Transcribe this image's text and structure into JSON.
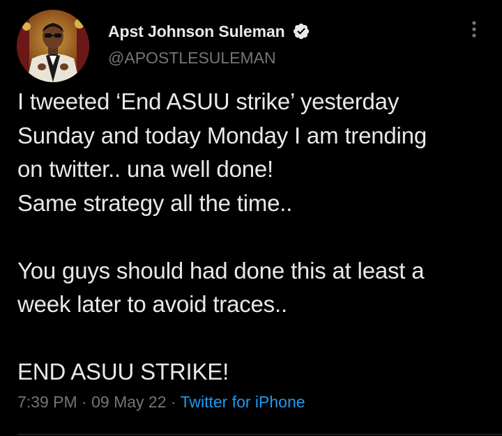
{
  "author": {
    "display_name": "Apst Johnson Suleman",
    "handle": "@APOSTLESULEMAN",
    "verified_icon": "verified-badge-icon",
    "avatar_icon": "profile-avatar"
  },
  "more_icon": "more-vertical-icon",
  "tweet": {
    "lines": [
      "I tweeted ‘End ASUU strike’ yesterday",
      "Sunday and today Monday I am trending",
      "on twitter.. una well done!",
      "Same strategy all the time..",
      "",
      "You guys should had done this at least a",
      "week later to avoid traces..",
      "",
      "END ASUU STRIKE!"
    ]
  },
  "meta": {
    "time": "7:39 PM",
    "separator": "·",
    "date": "09 May 22",
    "source": "Twitter for iPhone"
  },
  "colors": {
    "background": "#000000",
    "text": "#e7e9ea",
    "secondary": "#71767b",
    "link": "#1d9bf0"
  }
}
